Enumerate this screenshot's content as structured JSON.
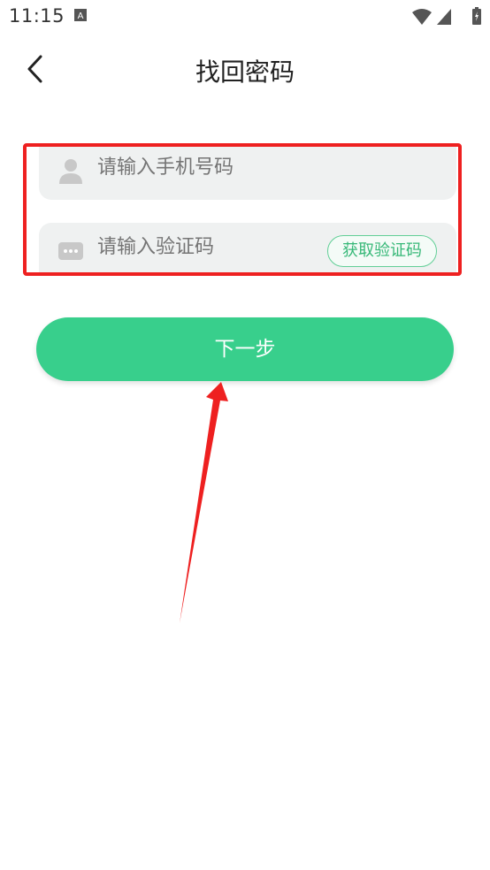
{
  "status_bar": {
    "time": "11:15",
    "icons": [
      "a-notification-icon",
      "wifi-icon",
      "signal-icon",
      "battery-icon"
    ]
  },
  "header": {
    "title": "找回密码",
    "back_icon": "chevron-left-icon"
  },
  "form": {
    "phone": {
      "placeholder": "请输入手机号码",
      "icon": "user-icon"
    },
    "code": {
      "placeholder": "请输入验证码",
      "icon": "message-icon",
      "button_label": "获取验证码"
    }
  },
  "next_button": {
    "label": "下一步"
  },
  "colors": {
    "accent": "#38cf8c",
    "highlight": "#ee2020",
    "field_bg": "#eff1f1",
    "placeholder": "#9a9a9a"
  }
}
